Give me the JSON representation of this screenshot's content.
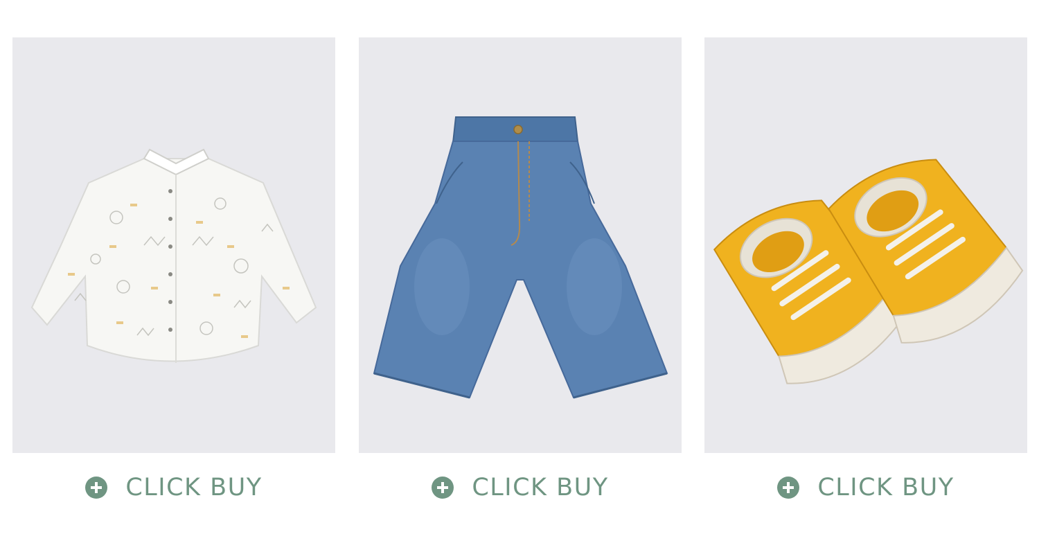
{
  "accent_color": "#6f9582",
  "image_background": "#e9e9ed",
  "products": [
    {
      "name": "shirt",
      "image_icon": "white-printed-shirt",
      "cta_icon": "plus-circle-icon",
      "cta_label": "CLICK BUY"
    },
    {
      "name": "jeans",
      "image_icon": "blue-denim-pants",
      "cta_icon": "plus-circle-icon",
      "cta_label": "CLICK BUY"
    },
    {
      "name": "sneakers",
      "image_icon": "yellow-canvas-sneakers",
      "cta_icon": "plus-circle-icon",
      "cta_label": "CLICK BUY"
    }
  ]
}
